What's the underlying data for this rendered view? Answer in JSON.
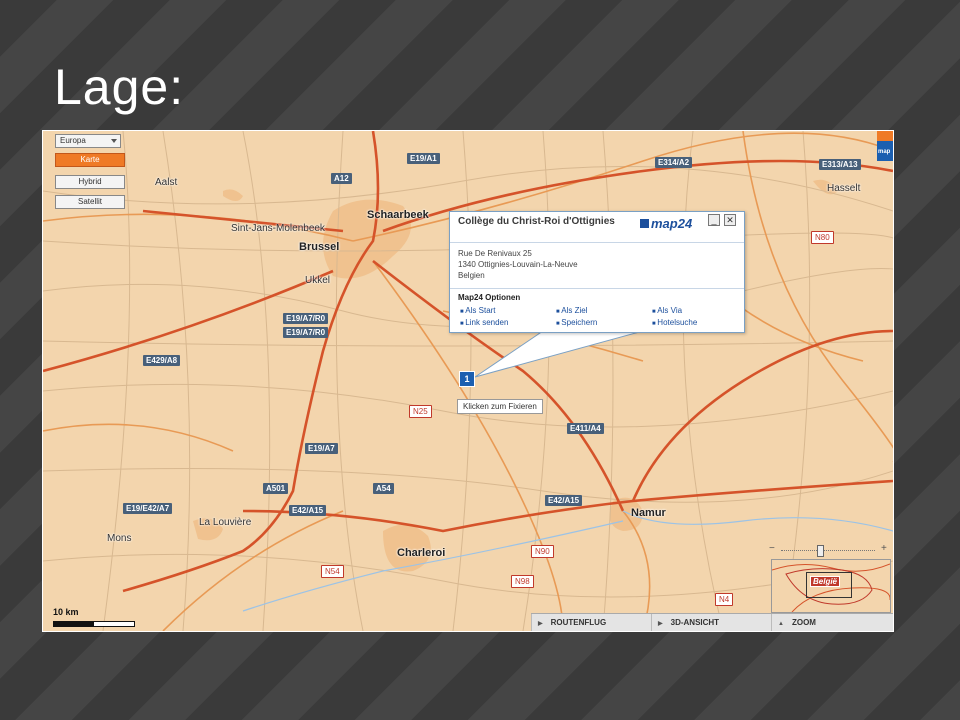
{
  "slide": {
    "title": "Lage:"
  },
  "map": {
    "provider_logo": "map24",
    "map_type_dropdown": "Europa",
    "map_types": [
      "Karte",
      "Hybrid",
      "Satellit"
    ],
    "active_map_type": "Karte",
    "scale_label": "10 km",
    "cities": [
      "Aalst",
      "Schaarbeek",
      "Sint-Jans-Molenbeek",
      "Brussel",
      "Ukkel",
      "Hasselt",
      "La Louvière",
      "Mons",
      "Charleroi",
      "Namur"
    ],
    "roads": {
      "motorways": [
        "E19/A1",
        "A12",
        "E314/A2",
        "E313/A13",
        "E19/A7/R0",
        "E19/A7/R0",
        "E429/A8",
        "E19/A7",
        "A501",
        "A54",
        "E19/E42/A7",
        "E42/A15",
        "E411/A4",
        "E42/A15"
      ],
      "national": [
        "N80",
        "N25",
        "N90",
        "N54",
        "N98",
        "N4"
      ]
    },
    "popup": {
      "title": "Collège du Christ-Roi d'Ottignies",
      "address_lines": [
        "Rue De Renivaux 25",
        "1340 Ottignies-Louvain-La-Neuve",
        "Belgien"
      ],
      "options_title": "Map24 Optionen",
      "options": [
        "Als Start",
        "Als Ziel",
        "Als Via",
        "Link senden",
        "Speichern",
        "Hotelsuche"
      ],
      "minimize": "_",
      "close": "✕"
    },
    "marker_label": "1",
    "tooltip": "Klicken zum Fixieren",
    "bottom_buttons": [
      "ROUTENFLUG",
      "3D-ANSICHT",
      "ZOOM"
    ],
    "overview_label": "België",
    "zoom_controls": {
      "minus": "−",
      "plus": "+"
    }
  }
}
